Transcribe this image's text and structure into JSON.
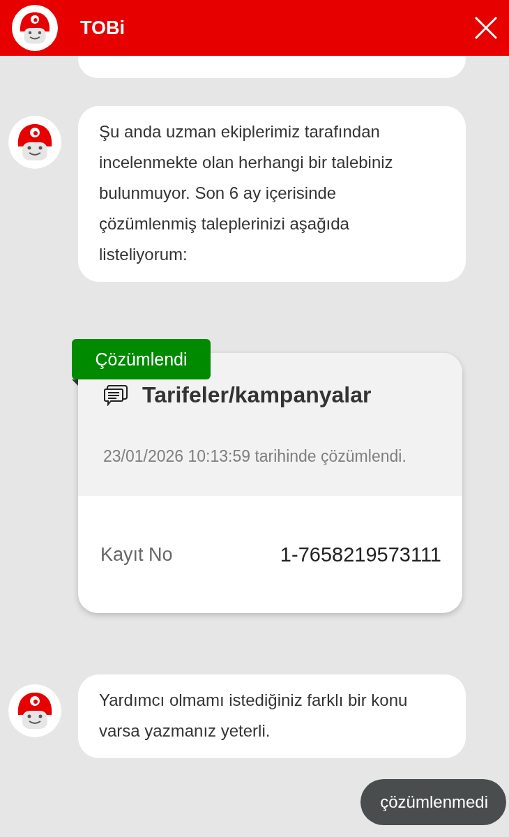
{
  "header": {
    "title": "TOBi"
  },
  "messages": [
    {
      "kind": "partial"
    },
    {
      "kind": "bot",
      "text": "Şu anda uzman ekiplerimiz tarafından incelenmekte olan herhangi bir talebiniz bulunmuyor. Son 6 ay içerisinde çözümlenmiş taleplerinizi aşağıda listeliyorum:"
    },
    {
      "kind": "ticket",
      "status": "Çözümlendi",
      "color": "#008a00",
      "title": "Tarifeler/kampanyalar",
      "resolved": "23/01/2026 10:13:59 tarihinde çözümlendi.",
      "field_label": "Kayıt No",
      "field_value": "1-7658219573111"
    },
    {
      "kind": "bot",
      "text": "Yardımcı olmamı istediğiniz farklı bir konu varsa yazmanız yeterli."
    }
  ],
  "quick_reply": "çözümlenmedi"
}
